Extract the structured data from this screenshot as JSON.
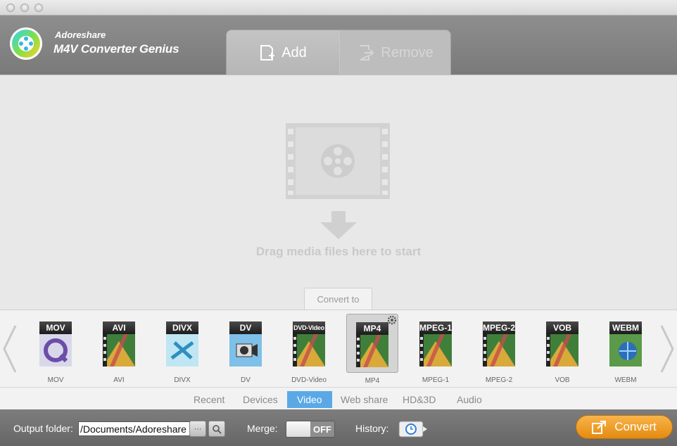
{
  "app": {
    "brand": "Adoreshare",
    "name": "M4V Converter Genius"
  },
  "toolbar": {
    "add_label": "Add",
    "remove_label": "Remove"
  },
  "drop_area": {
    "message": "Drag media files here to start",
    "convert_to_label": "Convert to"
  },
  "formats": [
    {
      "badge": "MOV",
      "label": "MOV",
      "art": "quicktime"
    },
    {
      "badge": "AVI",
      "label": "AVI",
      "art": "film"
    },
    {
      "badge": "DIVX",
      "label": "DIVX",
      "art": "divx"
    },
    {
      "badge": "DV",
      "label": "DV",
      "art": "camcorder"
    },
    {
      "badge": "DVD-Video",
      "label": "DVD-Video",
      "art": "film"
    },
    {
      "badge": "MP4",
      "label": "MP4",
      "art": "film",
      "selected": true
    },
    {
      "badge": "MPEG-1",
      "label": "MPEG-1",
      "art": "film"
    },
    {
      "badge": "MPEG-2",
      "label": "MPEG-2",
      "art": "film"
    },
    {
      "badge": "VOB",
      "label": "VOB",
      "art": "film"
    },
    {
      "badge": "WEBM",
      "label": "WEBM",
      "art": "globe"
    }
  ],
  "categories": {
    "recent": "Recent",
    "devices": "Devices",
    "video": "Video",
    "web_share": "Web share",
    "hd3d": "HD&3D",
    "audio": "Audio",
    "active": "Video"
  },
  "bottom": {
    "output_folder_label": "Output folder:",
    "output_folder_value": "/Documents/Adoreshare",
    "browse_label": "···",
    "merge_label": "Merge:",
    "merge_state": "OFF",
    "history_label": "History:",
    "convert_label": "Convert"
  },
  "colors": {
    "accent_blue": "#5aa9e6",
    "convert_orange": "#f0a02c",
    "header_gray": "#858585"
  }
}
